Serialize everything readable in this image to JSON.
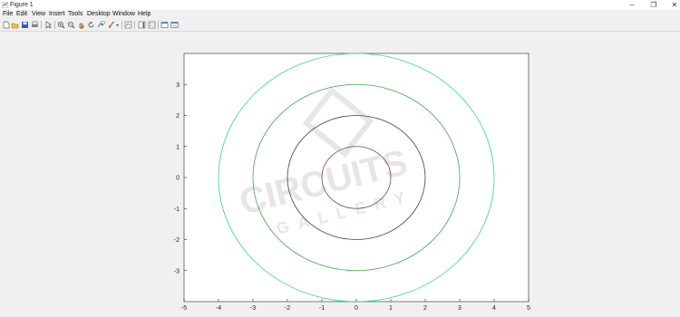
{
  "window": {
    "title": "Figure 1"
  },
  "menu": [
    "File",
    "Edit",
    "View",
    "Insert",
    "Tools",
    "Desktop",
    "Window",
    "Help"
  ],
  "toolbar_icons": [
    "new-figure-icon",
    "open-file-icon",
    "save-icon",
    "print-icon",
    "pointer-icon",
    "zoom-in-icon",
    "zoom-out-icon",
    "pan-icon",
    "rotate-icon",
    "data-cursor-icon",
    "brush-icon",
    "brush-dropdown-icon",
    "link-plot-icon",
    "colorbar-icon",
    "legend-icon",
    "hide-plot-tools-icon",
    "show-plot-tools-icon"
  ],
  "watermark": {
    "top": "CIRCUITS",
    "bottom": "GALLERY"
  },
  "chart_data": {
    "type": "line",
    "title": "",
    "xlabel": "",
    "ylabel": "",
    "xlim": [
      -5,
      5
    ],
    "ylim": [
      -4,
      4
    ],
    "xticks": [
      "-5",
      "-4",
      "-3",
      "-2",
      "-1",
      "0",
      "1",
      "2",
      "3",
      "4",
      "5"
    ],
    "yticks": [
      "-3",
      "-2",
      "-1",
      "0",
      "1",
      "2",
      "3"
    ],
    "grid": false,
    "series": [
      {
        "shape": "circle",
        "center": [
          0,
          0
        ],
        "radius": 1,
        "color": "#7a3f6e"
      },
      {
        "shape": "circle",
        "center": [
          0,
          0
        ],
        "radius": 2,
        "color": "#4a3a4a"
      },
      {
        "shape": "circle",
        "center": [
          0,
          0
        ],
        "radius": 3,
        "color": "#3aa84a"
      },
      {
        "shape": "circle",
        "center": [
          0,
          0
        ],
        "radius": 4,
        "color": "#2ed3a0"
      }
    ]
  }
}
